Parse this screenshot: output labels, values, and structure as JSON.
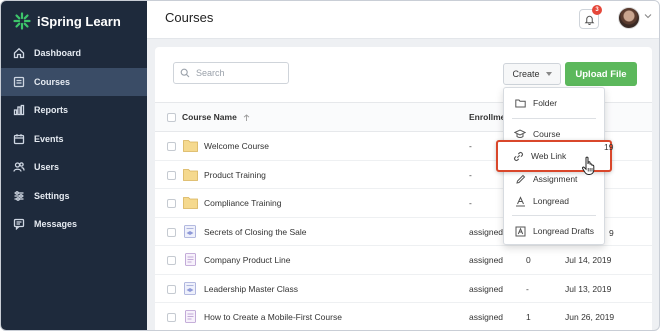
{
  "app": {
    "brand_name": "iSpring Learn"
  },
  "colors": {
    "sidebar_bg": "#1e2a3c",
    "sidebar_active": "#3a4c66",
    "upload_green": "#5cb85c",
    "highlight_red": "#d9472b",
    "badge_red": "#e5473a"
  },
  "sidebar": {
    "items": [
      {
        "label": "Dashboard",
        "icon": "home-icon"
      },
      {
        "label": "Courses",
        "icon": "courses-icon",
        "active": true
      },
      {
        "label": "Reports",
        "icon": "bar-chart-icon"
      },
      {
        "label": "Events",
        "icon": "calendar-icon"
      },
      {
        "label": "Users",
        "icon": "users-icon"
      },
      {
        "label": "Settings",
        "icon": "sliders-icon"
      },
      {
        "label": "Messages",
        "icon": "message-icon"
      }
    ]
  },
  "header": {
    "title": "Courses",
    "notification_count": "3"
  },
  "toolbar": {
    "search_placeholder": "Search",
    "create_label": "Create",
    "upload_label": "Upload File"
  },
  "table": {
    "headers": {
      "name": "Course Name",
      "enrollment": "Enrollme"
    },
    "rows": [
      {
        "name": "Welcome Course",
        "type": "folder",
        "enrollment": "-",
        "count": "",
        "date": ""
      },
      {
        "name": "Product Training",
        "type": "folder",
        "enrollment": "-",
        "count": "",
        "date": ""
      },
      {
        "name": "Compliance Training",
        "type": "folder",
        "enrollment": "-",
        "count": "",
        "date": ""
      },
      {
        "name": "Secrets of Closing the Sale",
        "type": "course",
        "enrollment": "assigned",
        "count": "",
        "date": ""
      },
      {
        "name": "Company Product Line",
        "type": "document",
        "enrollment": "assigned",
        "count": "0",
        "date": "Jul 14, 2019"
      },
      {
        "name": "Leadership Master Class",
        "type": "course",
        "enrollment": "assigned",
        "count": "-",
        "date": "Jul 13, 2019"
      },
      {
        "name": "How to Create a Mobile-First Course",
        "type": "document",
        "enrollment": "assigned",
        "count": "1",
        "date": "Jun 26, 2019"
      }
    ],
    "partial_dates": [
      "19",
      "9"
    ]
  },
  "create_menu": {
    "items": [
      {
        "label": "Folder",
        "icon": "folder-icon"
      },
      {
        "label": "Course",
        "icon": "graduation-cap-icon"
      },
      {
        "label": "Web Link",
        "icon": "link-icon",
        "highlighted": true
      },
      {
        "label": "Assignment",
        "icon": "pencil-icon"
      },
      {
        "label": "Longread",
        "icon": "text-a-icon"
      },
      {
        "label": "Longread Drafts",
        "icon": "draft-icon"
      }
    ]
  }
}
